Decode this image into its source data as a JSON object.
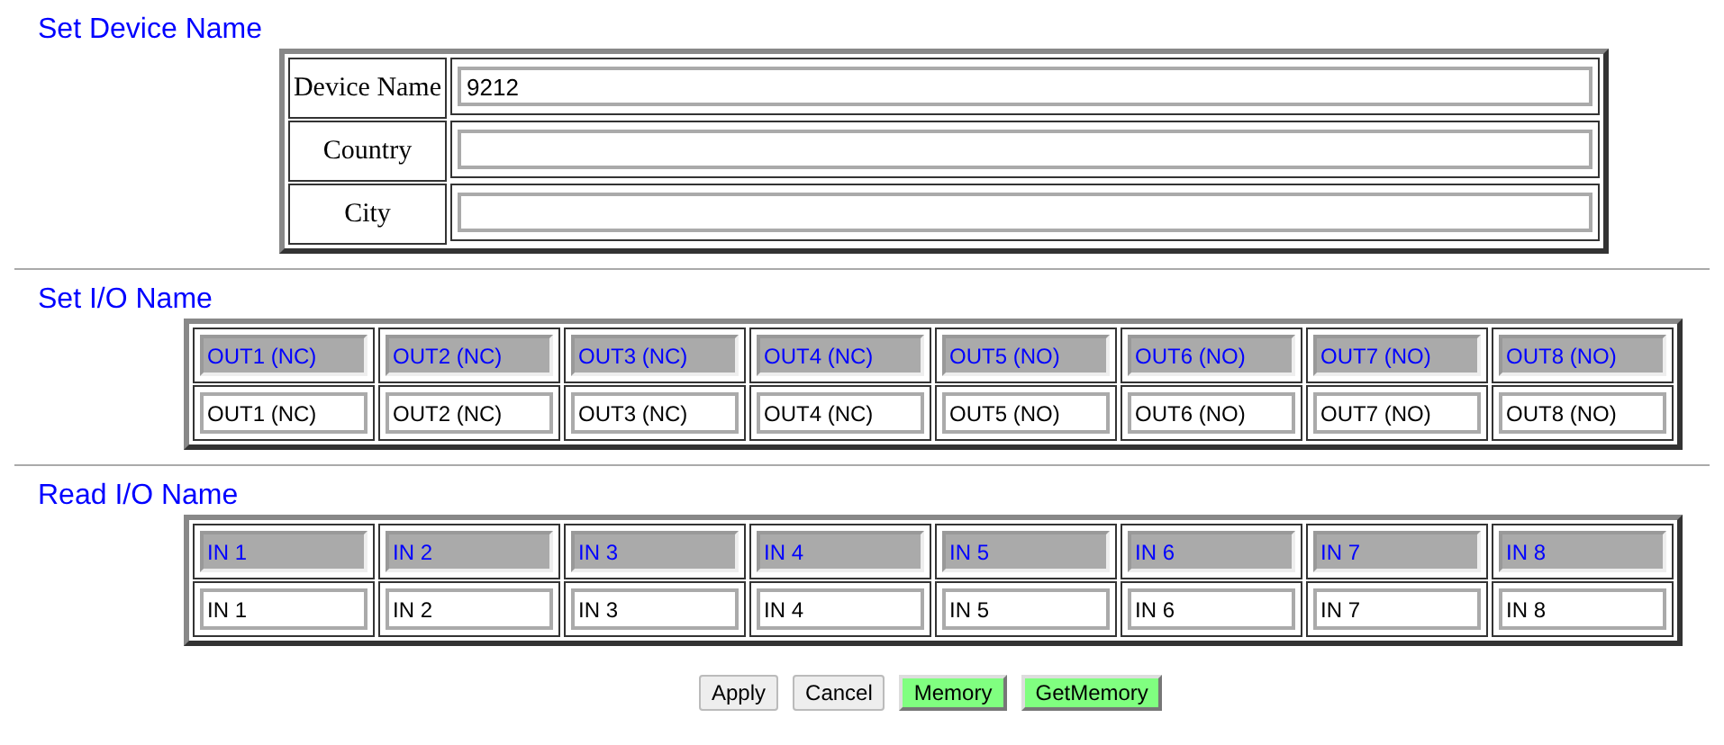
{
  "device_section": {
    "title": "Set Device Name",
    "fields": [
      {
        "label": "Device Name",
        "value": "9212"
      },
      {
        "label": "Country"
      },
      {
        "label": "City"
      }
    ]
  },
  "set_io_section": {
    "title": "Set I/O Name",
    "rows": [
      {
        "kind": "current",
        "values": [
          "OUT1 (NC)",
          "OUT2 (NC)",
          "OUT3 (NC)",
          "OUT4 (NC)",
          "OUT5 (NO)",
          "OUT6 (NO)",
          "OUT7 (NO)",
          "OUT8 (NO)"
        ]
      },
      {
        "kind": "edit",
        "values": [
          "OUT1 (NC)",
          "OUT2 (NC)",
          "OUT3 (NC)",
          "OUT4 (NC)",
          "OUT5 (NO)",
          "OUT6 (NO)",
          "OUT7 (NO)",
          "OUT8 (NO)"
        ]
      }
    ]
  },
  "read_io_section": {
    "title": "Read I/O Name",
    "rows": [
      {
        "kind": "current",
        "values": [
          "IN 1",
          "IN 2",
          "IN 3",
          "IN 4",
          "IN 5",
          "IN 6",
          "IN 7",
          "IN 8"
        ]
      },
      {
        "kind": "edit",
        "values": [
          "IN 1",
          "IN 2",
          "IN 3",
          "IN 4",
          "IN 5",
          "IN 6",
          "IN 7",
          "IN 8"
        ]
      }
    ]
  },
  "buttons": [
    {
      "label": "Apply",
      "kind": "plain"
    },
    {
      "label": "Cancel",
      "kind": "plain"
    },
    {
      "label": "Memory",
      "kind": "memory"
    },
    {
      "label": "GetMemory",
      "kind": "memory"
    }
  ]
}
